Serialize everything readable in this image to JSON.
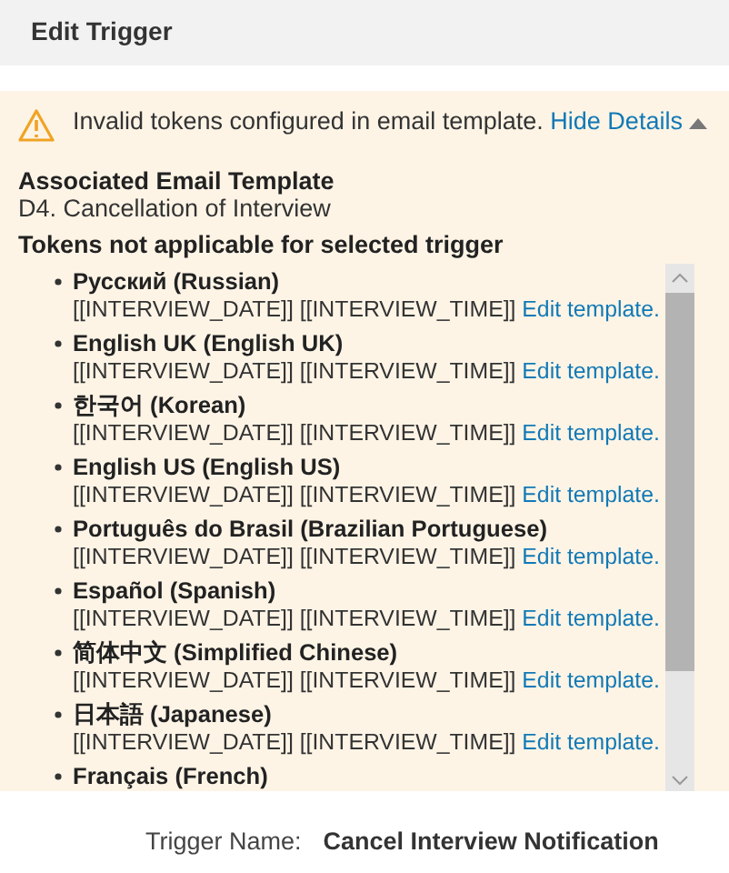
{
  "dialog": {
    "title": "Edit Trigger"
  },
  "warning": {
    "message": "Invalid tokens configured in email template.",
    "toggle_link": "Hide Details",
    "expanded": true
  },
  "template": {
    "heading": "Associated Email Template",
    "name": "D4. Cancellation of Interview"
  },
  "tokens_heading": "Tokens not applicable for selected trigger",
  "languages": [
    {
      "name": "Русский (Russian)",
      "tokens": "[[INTERVIEW_DATE]] [[INTERVIEW_TIME]]",
      "link": "Edit template."
    },
    {
      "name": "English UK (English UK)",
      "tokens": "[[INTERVIEW_DATE]] [[INTERVIEW_TIME]]",
      "link": "Edit template."
    },
    {
      "name": "한국어 (Korean)",
      "tokens": "[[INTERVIEW_DATE]] [[INTERVIEW_TIME]]",
      "link": "Edit template."
    },
    {
      "name": "English US (English US)",
      "tokens": "[[INTERVIEW_DATE]] [[INTERVIEW_TIME]]",
      "link": "Edit template."
    },
    {
      "name": "Português do Brasil (Brazilian Portuguese)",
      "tokens": "[[INTERVIEW_DATE]] [[INTERVIEW_TIME]]",
      "link": "Edit template."
    },
    {
      "name": "Español (Spanish)",
      "tokens": "[[INTERVIEW_DATE]] [[INTERVIEW_TIME]]",
      "link": "Edit template."
    },
    {
      "name": "简体中文 (Simplified Chinese)",
      "tokens": "[[INTERVIEW_DATE]] [[INTERVIEW_TIME]]",
      "link": "Edit template."
    },
    {
      "name": "日本語 (Japanese)",
      "tokens": "[[INTERVIEW_DATE]] [[INTERVIEW_TIME]]",
      "link": "Edit template."
    },
    {
      "name": "Français (French)"
    }
  ],
  "trigger_name": {
    "label": "Trigger Name:",
    "value": "Cancel Interview Notification"
  }
}
